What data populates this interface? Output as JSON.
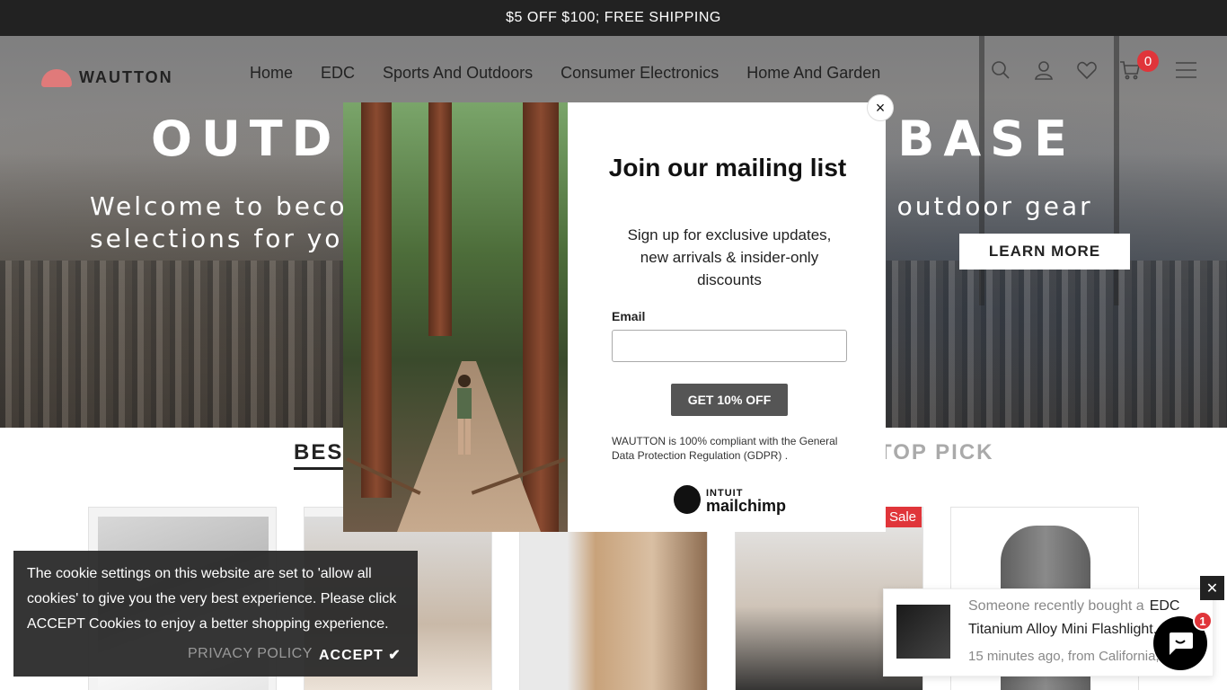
{
  "announcement": "$5 OFF $100; FREE SHIPPING",
  "brand": {
    "name": "WAUTTON"
  },
  "nav": [
    "Home",
    "EDC",
    "Sports And Outdoors",
    "Consumer Electronics",
    "Home And Garden"
  ],
  "header_icons": {
    "search": "search-icon",
    "account": "user-icon",
    "wishlist": "heart-icon",
    "cart": "cart-icon",
    "menu": "hamburger-icon"
  },
  "cart_count": "0",
  "hero": {
    "title": "OUTDOOR SHOPPING BASE",
    "subtitle": "Welcome to become our member for a wide range of outdoor gear selections for your adventure.",
    "button": "LEARN MORE"
  },
  "sections": {
    "left": "BEST SELLERS",
    "right": "TOP PICK"
  },
  "product_badge": "Sale",
  "popup": {
    "title": "Join our mailing list",
    "description": "Sign up for exclusive updates, new arrivals & insider-only discounts",
    "email_label": "Email",
    "email_value": "",
    "button": "GET 10% OFF",
    "gdpr": "WAUTTON is 100% compliant with the General Data Protection Regulation (GDPR) .",
    "powered_a": "INTUIT",
    "powered_b": "mailchimp",
    "close": "×"
  },
  "cookie": {
    "message": "The cookie settings on this website are set to 'allow all cookies' to give you the very best experience. Please click ACCEPT Cookies to enjoy a better shopping experience.",
    "privacy": "PRIVACY POLICY",
    "accept": "ACCEPT ✔"
  },
  "recent_purchase": {
    "lead": "Someone recently bought a",
    "product_start": "EDC",
    "product_rest": "Titanium Alloy Mini Flashlight...",
    "when": "15 minutes ago, from California,"
  },
  "recent_close": "✕",
  "chat_badge": "1",
  "colors": {
    "accent": "#e0353a",
    "dark": "#222222"
  }
}
